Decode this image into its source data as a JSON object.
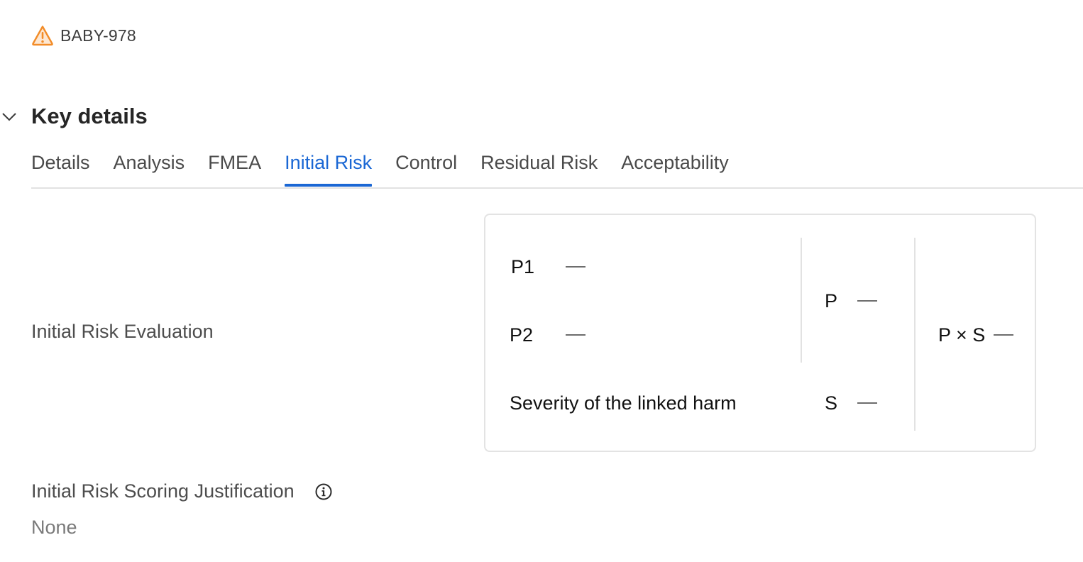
{
  "issue": {
    "id": "BABY-978",
    "icon": "warning-triangle-icon",
    "icon_color": "#f28c28"
  },
  "section": {
    "title": "Key details",
    "collapse_icon": "chevron-down-icon"
  },
  "tabs": [
    {
      "label": "Details",
      "active": false
    },
    {
      "label": "Analysis",
      "active": false
    },
    {
      "label": "FMEA",
      "active": false
    },
    {
      "label": "Initial Risk",
      "active": true
    },
    {
      "label": "Control",
      "active": false
    },
    {
      "label": "Residual Risk",
      "active": false
    },
    {
      "label": "Acceptability",
      "active": false
    }
  ],
  "accent_color": "#1a67d4",
  "evaluation": {
    "label": "Initial Risk Evaluation",
    "p1_label": "P1",
    "p1_value": "—",
    "p2_label": "P2",
    "p2_value": "—",
    "severity_label": "Severity of the linked harm",
    "p_label": "P",
    "p_value": "—",
    "s_label": "S",
    "s_value": "—",
    "pxs_label": "P × S",
    "pxs_value": "—"
  },
  "justification": {
    "label": "Initial Risk Scoring Justification",
    "info_icon": "info-circle-icon",
    "value": "None"
  }
}
